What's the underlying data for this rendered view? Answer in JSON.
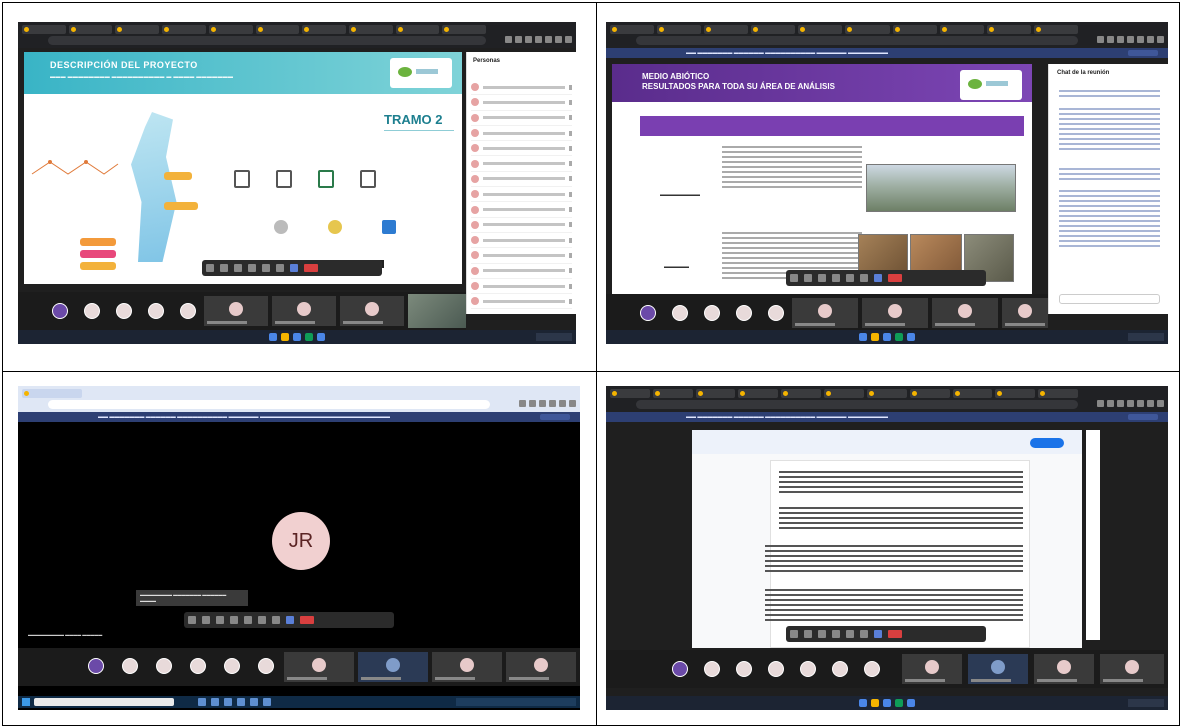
{
  "panel1": {
    "slide_title": "DESCRIPCIÓN DEL PROYECTO",
    "tramo": "TRAMO 2",
    "people_header": "Personas"
  },
  "panel2": {
    "slide_title_line1": "MEDIO ABIÓTICO",
    "slide_title_line2": "RESULTADOS PARA TODA SU ÁREA DE ANÁLISIS",
    "chat_header": "Chat de la reunión"
  },
  "panel3": {
    "avatar_initials": "JR"
  },
  "colors": {
    "slide1_teal": "#39b4c6",
    "slide2_purple": "#5a2c8c",
    "end_call_red": "#d93f3f",
    "meet_banner": "#2d3f73"
  }
}
